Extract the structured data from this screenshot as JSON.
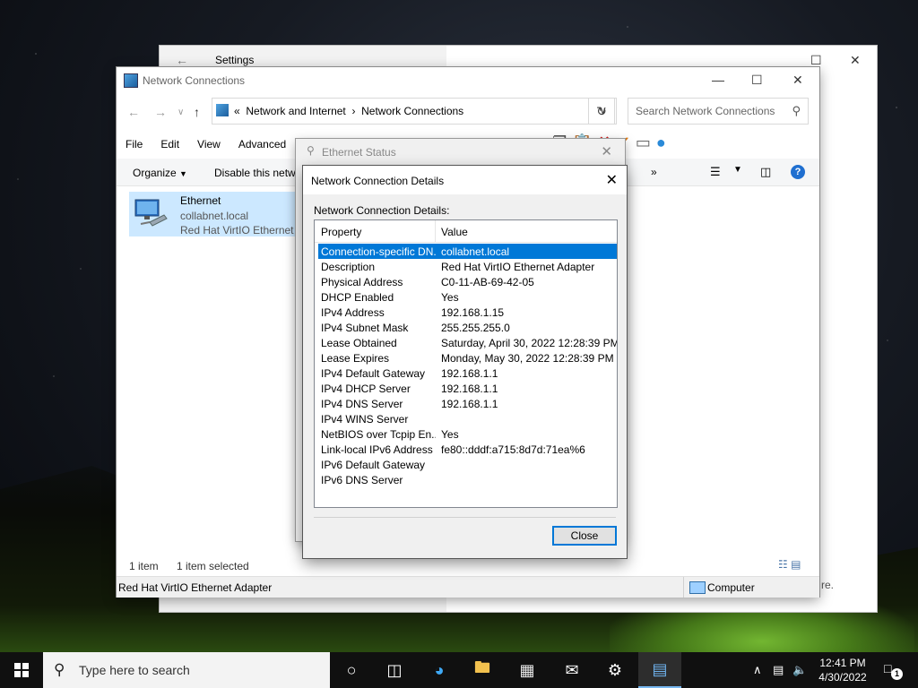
{
  "settings": {
    "title": "Settings",
    "partial_text": "re."
  },
  "explorer": {
    "title": "Network Connections",
    "breadcrumb": [
      "Network and Internet",
      "Network Connections"
    ],
    "breadcrumb_prefix": "«",
    "search_placeholder": "Search Network Connections",
    "menu": [
      "File",
      "Edit",
      "View",
      "Advanced",
      "To"
    ],
    "organize_label": "Organize",
    "disable_label": "Disable this netw",
    "cmd_partial": "h",
    "cmd_more": "»",
    "item": {
      "name": "Ethernet",
      "domain": "collabnet.local",
      "device": "Red Hat VirtIO Ethernet A"
    },
    "status_count": "1 item",
    "status_selected": "1 item selected",
    "footer_left": "Red Hat VirtIO Ethernet Adapter",
    "footer_right": "Computer"
  },
  "ethernet_status": {
    "title": "Ethernet Status"
  },
  "details": {
    "title": "Network Connection Details",
    "label": "Network Connection Details:",
    "col_property": "Property",
    "col_value": "Value",
    "rows": [
      {
        "k": "Connection-specific DN...",
        "v": "collabnet.local"
      },
      {
        "k": "Description",
        "v": "Red Hat VirtIO Ethernet Adapter"
      },
      {
        "k": "Physical Address",
        "v": "C0-11-AB-69-42-05"
      },
      {
        "k": "DHCP Enabled",
        "v": "Yes"
      },
      {
        "k": "IPv4 Address",
        "v": "192.168.1.15"
      },
      {
        "k": "IPv4 Subnet Mask",
        "v": "255.255.255.0"
      },
      {
        "k": "Lease Obtained",
        "v": "Saturday, April 30, 2022 12:28:39 PM"
      },
      {
        "k": "Lease Expires",
        "v": "Monday, May 30, 2022 12:28:39 PM"
      },
      {
        "k": "IPv4 Default Gateway",
        "v": "192.168.1.1"
      },
      {
        "k": "IPv4 DHCP Server",
        "v": "192.168.1.1"
      },
      {
        "k": "IPv4 DNS Server",
        "v": "192.168.1.1"
      },
      {
        "k": "IPv4 WINS Server",
        "v": ""
      },
      {
        "k": "NetBIOS over Tcpip En...",
        "v": "Yes"
      },
      {
        "k": "Link-local IPv6 Address",
        "v": "fe80::dddf:a715:8d7d:71ea%6"
      },
      {
        "k": "IPv6 Default Gateway",
        "v": ""
      },
      {
        "k": "IPv6 DNS Server",
        "v": ""
      }
    ],
    "close_label": "Close"
  },
  "taskbar": {
    "search_placeholder": "Type here to search",
    "time": "12:41 PM",
    "date": "4/30/2022",
    "notification_count": "1"
  },
  "colors": {
    "selection": "#0078d7",
    "taskbar": "#101010",
    "item_highlight": "#cce8ff"
  }
}
